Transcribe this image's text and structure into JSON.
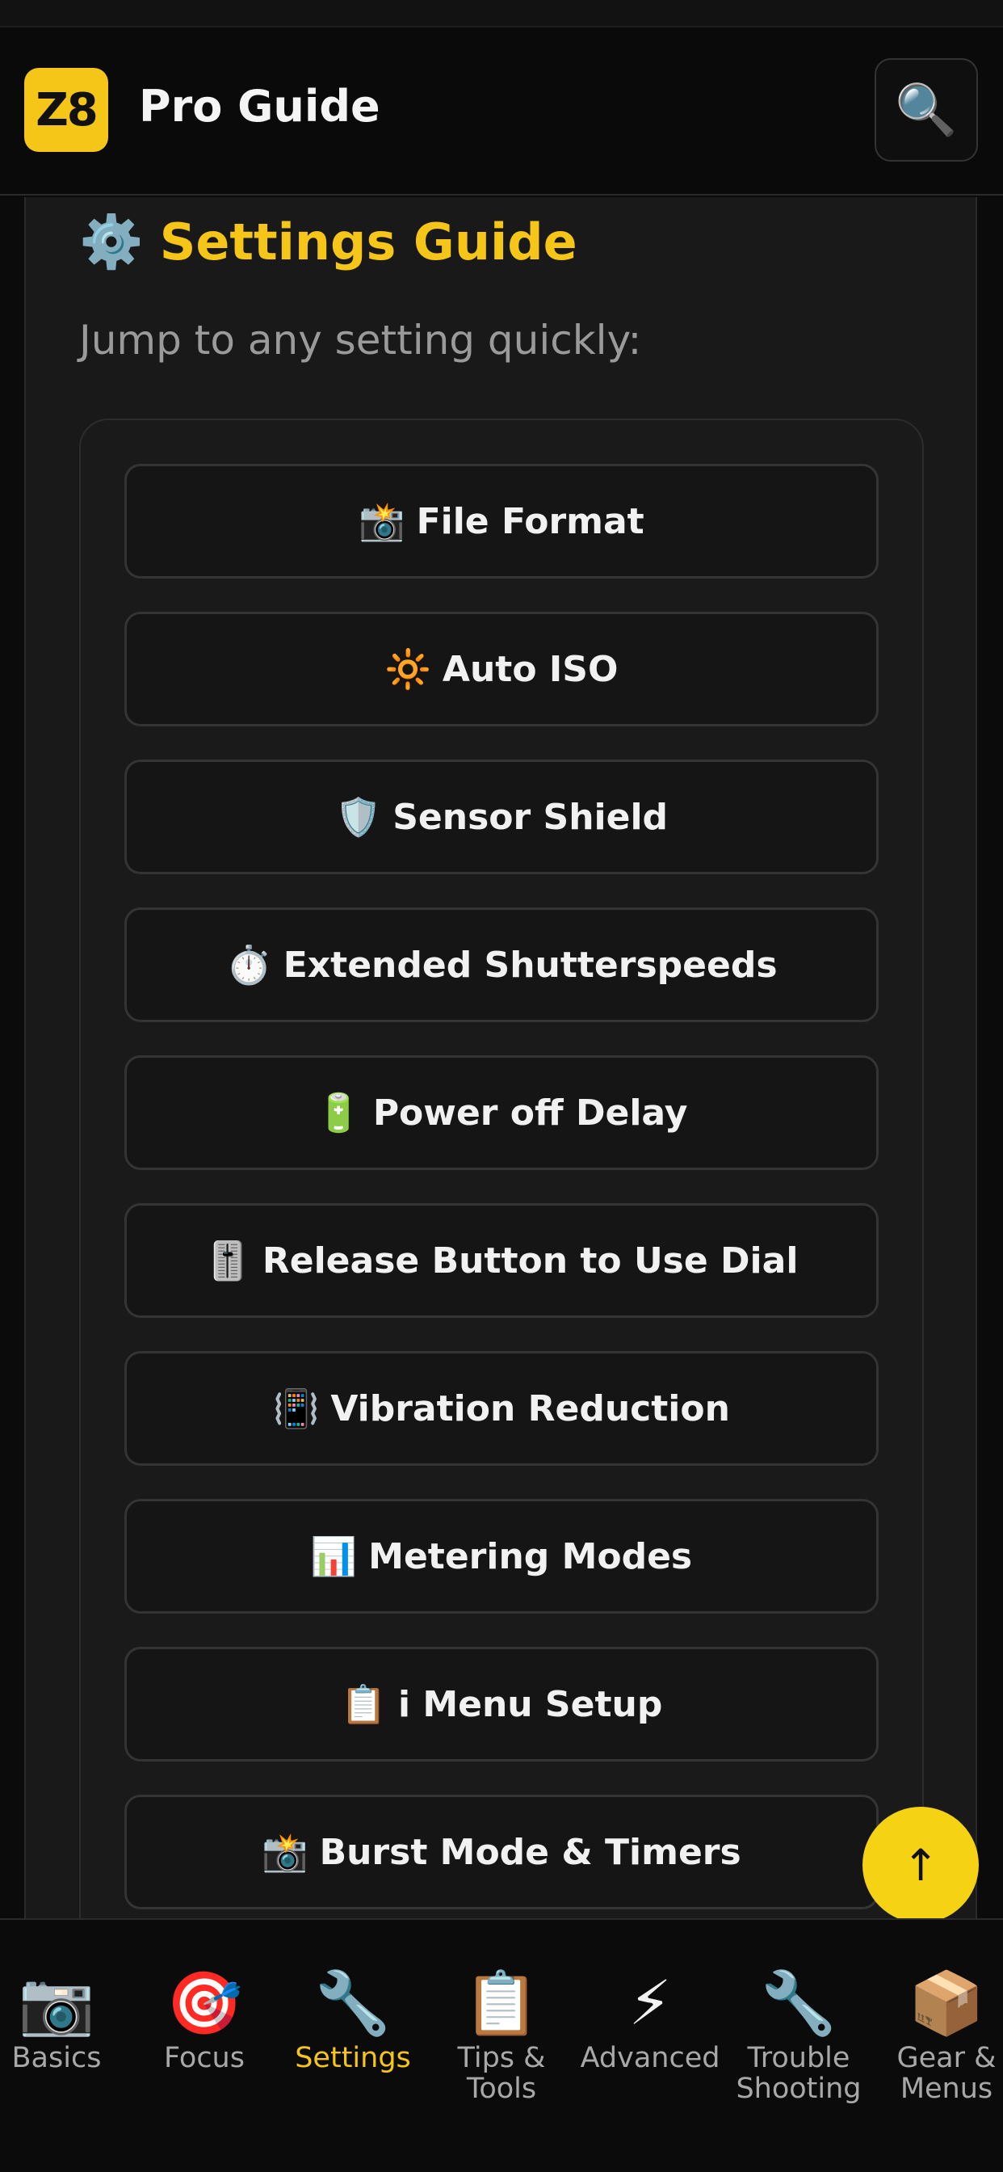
{
  "header": {
    "logo_text": "Z8",
    "title": "Pro Guide",
    "search_icon": "🔍"
  },
  "section": {
    "icon": "⚙️",
    "title": "Settings Guide",
    "subtitle": "Jump to any setting quickly:"
  },
  "settings_buttons": [
    {
      "icon": "📸",
      "label": "File Format"
    },
    {
      "icon": "🔆",
      "label": "Auto ISO"
    },
    {
      "icon": "🛡️",
      "label": "Sensor Shield"
    },
    {
      "icon": "⏱️",
      "label": "Extended Shutterspeeds"
    },
    {
      "icon": "🔋",
      "label": "Power off Delay"
    },
    {
      "icon": "🎚️",
      "label": "Release Button to Use Dial"
    },
    {
      "icon": "📳",
      "label": "Vibration Reduction"
    },
    {
      "icon": "📊",
      "label": "Metering Modes"
    },
    {
      "icon": "📋",
      "label": "i Menu Setup"
    },
    {
      "icon": "📸",
      "label": "Burst Mode & Timers"
    }
  ],
  "fab": {
    "icon": "↑"
  },
  "tabs": [
    {
      "icon": "📷",
      "label": "Basics",
      "active": false
    },
    {
      "icon": "🎯",
      "label": "Focus",
      "active": false
    },
    {
      "icon": "🔧",
      "label": "Settings",
      "active": true
    },
    {
      "icon": "📋",
      "label": "Tips &\nTools",
      "active": false
    },
    {
      "icon": "⚡",
      "label": "Advanced",
      "active": false
    },
    {
      "icon": "🔧",
      "label": "Trouble\nShooting",
      "active": false
    },
    {
      "icon": "📦",
      "label": "Gear &\nMenus",
      "active": false
    }
  ],
  "colors": {
    "accent": "#f5c518",
    "background": "#0b0b0b",
    "panel": "#191919"
  }
}
